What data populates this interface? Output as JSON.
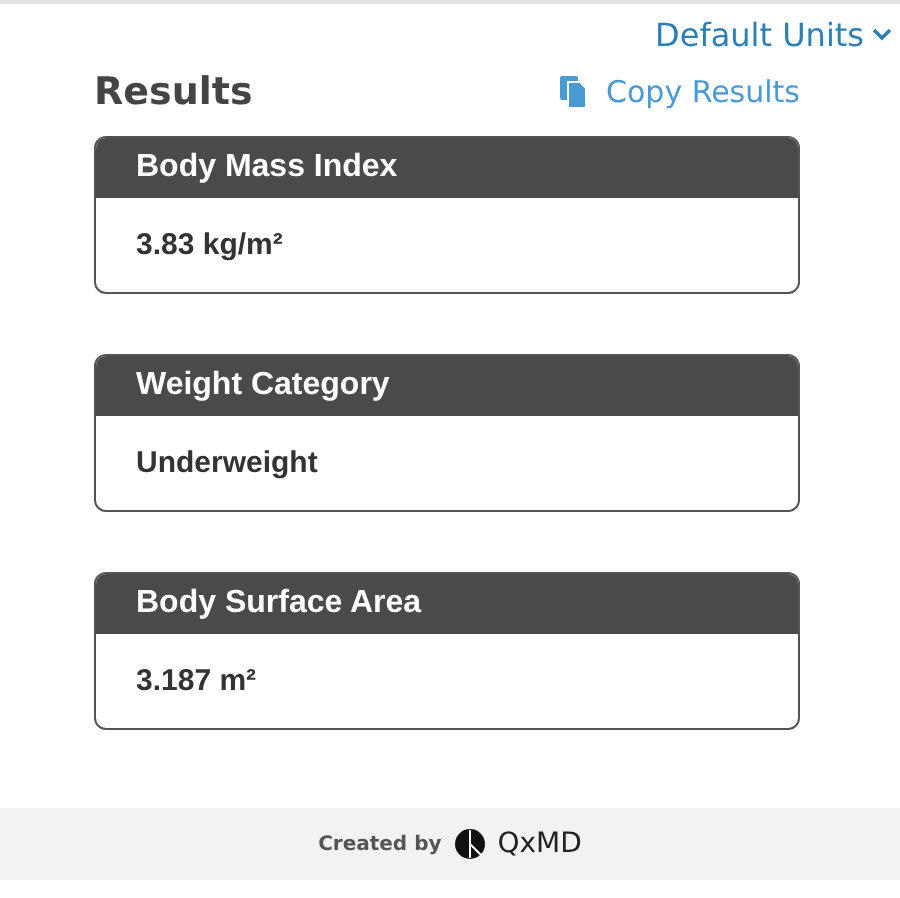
{
  "units_menu": {
    "label": "Default Units"
  },
  "results": {
    "title": "Results",
    "copy_label": "Copy Results",
    "cards": [
      {
        "title": "Body Mass Index",
        "value": "3.83 kg/m²"
      },
      {
        "title": "Weight Category",
        "value": "Underweight"
      },
      {
        "title": "Body Surface Area",
        "value": "3.187 m²"
      }
    ]
  },
  "footer": {
    "created_by": "Created by",
    "brand": "QxMD"
  }
}
